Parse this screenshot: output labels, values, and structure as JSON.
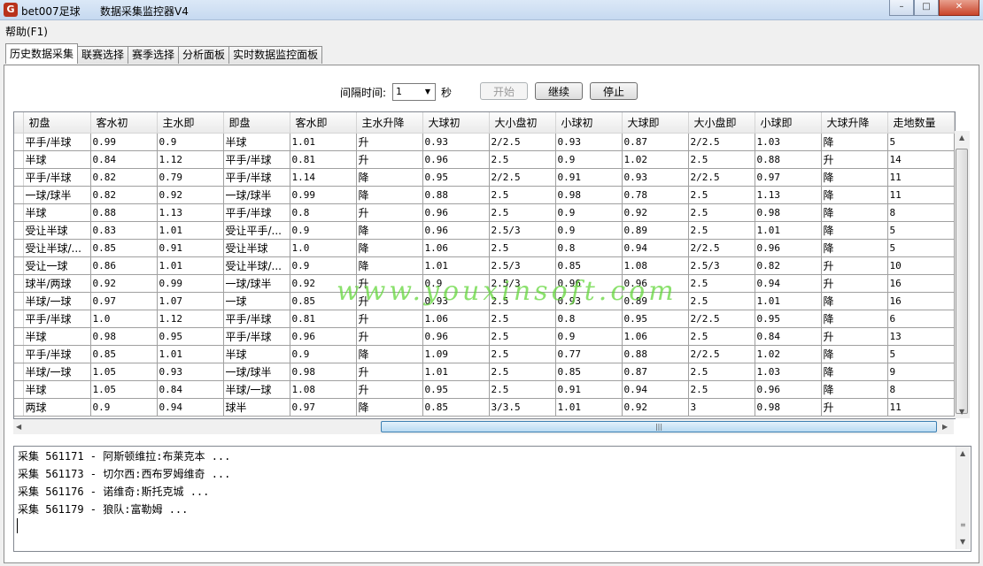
{
  "window": {
    "app_name": "bet007足球",
    "title": "数据采集监控器V4",
    "icon_glyph": "G",
    "minimize_glyph": "–",
    "maximize_glyph": "□",
    "close_glyph": "✕"
  },
  "menu": {
    "help": "帮助(F1)"
  },
  "tabs": [
    "历史数据采集",
    "联赛选择",
    "赛季选择",
    "分析面板",
    "实时数据监控面板"
  ],
  "controls": {
    "interval_label": "间隔时间:",
    "interval_value": "1",
    "interval_unit": "秒",
    "start": "开始",
    "continue": "继续",
    "stop": "停止"
  },
  "columns": [
    "初盘",
    "客水初",
    "主水即",
    "即盘",
    "客水即",
    "主水升降",
    "大球初",
    "大小盘初",
    "小球初",
    "大球即",
    "大小盘即",
    "小球即",
    "大球升降",
    "走地数量"
  ],
  "rows": [
    [
      "平手/半球",
      "0.99",
      "0.9",
      "半球",
      "1.01",
      "升",
      "0.93",
      "2/2.5",
      "0.93",
      "0.87",
      "2/2.5",
      "1.03",
      "降",
      "5"
    ],
    [
      "半球",
      "0.84",
      "1.12",
      "平手/半球",
      "0.81",
      "升",
      "0.96",
      "2.5",
      "0.9",
      "1.02",
      "2.5",
      "0.88",
      "升",
      "14"
    ],
    [
      "平手/半球",
      "0.82",
      "0.79",
      "平手/半球",
      "1.14",
      "降",
      "0.95",
      "2/2.5",
      "0.91",
      "0.93",
      "2/2.5",
      "0.97",
      "降",
      "11"
    ],
    [
      "一球/球半",
      "0.82",
      "0.92",
      "一球/球半",
      "0.99",
      "降",
      "0.88",
      "2.5",
      "0.98",
      "0.78",
      "2.5",
      "1.13",
      "降",
      "11"
    ],
    [
      "半球",
      "0.88",
      "1.13",
      "平手/半球",
      "0.8",
      "升",
      "0.96",
      "2.5",
      "0.9",
      "0.92",
      "2.5",
      "0.98",
      "降",
      "8"
    ],
    [
      "受让半球",
      "0.83",
      "1.01",
      "受让平手/...",
      "0.9",
      "降",
      "0.96",
      "2.5/3",
      "0.9",
      "0.89",
      "2.5",
      "1.01",
      "降",
      "5"
    ],
    [
      "受让半球/...",
      "0.85",
      "0.91",
      "受让半球",
      "1.0",
      "降",
      "1.06",
      "2.5",
      "0.8",
      "0.94",
      "2/2.5",
      "0.96",
      "降",
      "5"
    ],
    [
      "受让一球",
      "0.86",
      "1.01",
      "受让半球/...",
      "0.9",
      "降",
      "1.01",
      "2.5/3",
      "0.85",
      "1.08",
      "2.5/3",
      "0.82",
      "升",
      "10"
    ],
    [
      "球半/两球",
      "0.92",
      "0.99",
      "一球/球半",
      "0.92",
      "升",
      "0.9",
      "2.5/3",
      "0.96",
      "0.96",
      "2.5",
      "0.94",
      "升",
      "16"
    ],
    [
      "半球/一球",
      "0.97",
      "1.07",
      "一球",
      "0.85",
      "升",
      "0.93",
      "2.5",
      "0.93",
      "0.89",
      "2.5",
      "1.01",
      "降",
      "16"
    ],
    [
      "平手/半球",
      "1.0",
      "1.12",
      "平手/半球",
      "0.81",
      "升",
      "1.06",
      "2.5",
      "0.8",
      "0.95",
      "2/2.5",
      "0.95",
      "降",
      "6"
    ],
    [
      "半球",
      "0.98",
      "0.95",
      "平手/半球",
      "0.96",
      "升",
      "0.96",
      "2.5",
      "0.9",
      "1.06",
      "2.5",
      "0.84",
      "升",
      "13"
    ],
    [
      "平手/半球",
      "0.85",
      "1.01",
      "半球",
      "0.9",
      "降",
      "1.09",
      "2.5",
      "0.77",
      "0.88",
      "2/2.5",
      "1.02",
      "降",
      "5"
    ],
    [
      "半球/一球",
      "1.05",
      "0.93",
      "一球/球半",
      "0.98",
      "升",
      "1.01",
      "2.5",
      "0.85",
      "0.87",
      "2.5",
      "1.03",
      "降",
      "9"
    ],
    [
      "半球",
      "1.05",
      "0.84",
      "半球/一球",
      "1.08",
      "升",
      "0.95",
      "2.5",
      "0.91",
      "0.94",
      "2.5",
      "0.96",
      "降",
      "8"
    ],
    [
      "两球",
      "0.9",
      "0.94",
      "球半",
      "0.97",
      "降",
      "0.85",
      "3/3.5",
      "1.01",
      "0.92",
      "3",
      "0.98",
      "升",
      "11"
    ]
  ],
  "log_lines": [
    "采集 561171 - 阿斯顿维拉:布莱克本 ...",
    "采集 561173 - 切尔西:西布罗姆维奇 ...",
    "采集 561176 - 诺维奇:斯托克城 ...",
    "采集 561179 - 狼队:富勒姆 ..."
  ],
  "watermark": "www.youxinsoft.com",
  "colors": {
    "watermark": "#64d73c",
    "close_button": "#c9442a",
    "scroll_thumb": "#b9dbf3"
  }
}
